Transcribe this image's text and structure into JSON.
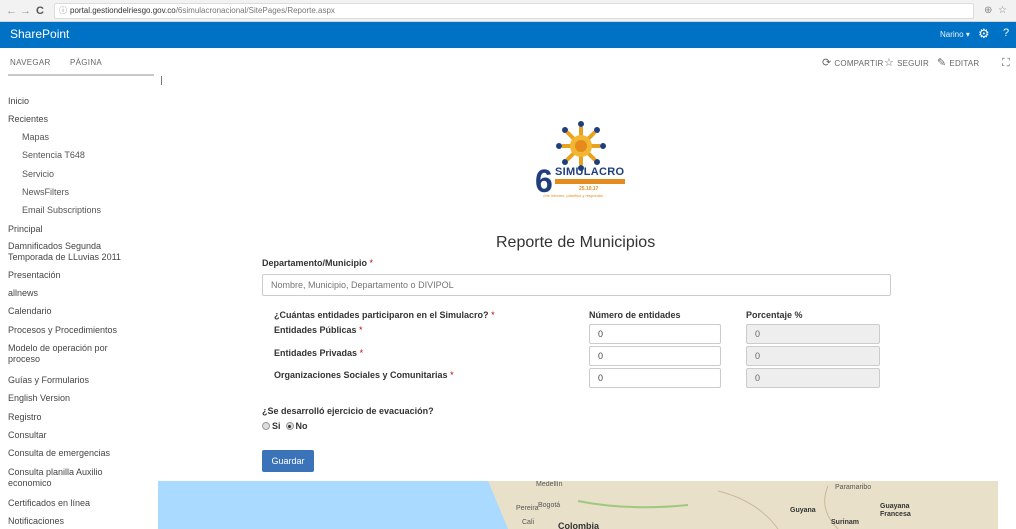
{
  "browser": {
    "url_host": "portal.gestiondelriesgo.gov.co",
    "url_path": "/6simulacronacional/SitePages/Reporte.aspx"
  },
  "suitebar": {
    "brand": "SharePoint",
    "user": "Narino"
  },
  "ribbon": {
    "tabs": [
      "NAVEGAR",
      "PÁGINA"
    ],
    "actions": {
      "share": "COMPARTIR",
      "follow": "SEGUIR",
      "edit": "EDITAR"
    }
  },
  "leftnav": {
    "items": [
      {
        "label": "Inicio",
        "sub": false
      },
      {
        "label": "Recientes",
        "sub": false
      },
      {
        "label": "Mapas",
        "sub": true
      },
      {
        "label": "Sentencia T648",
        "sub": true
      },
      {
        "label": "Servicio",
        "sub": true
      },
      {
        "label": "NewsFilters",
        "sub": true
      },
      {
        "label": "Email Subscriptions",
        "sub": true
      },
      {
        "label": "Principal",
        "sub": false
      },
      {
        "label": "Damnificados Segunda Temporada de LLuvias 2011",
        "sub": false
      },
      {
        "label": "Presentación",
        "sub": false
      },
      {
        "label": "allnews",
        "sub": false
      },
      {
        "label": "Calendario",
        "sub": false
      },
      {
        "label": "Procesos y Procedimientos",
        "sub": false
      },
      {
        "label": "Modelo de operación por proceso",
        "sub": false
      },
      {
        "label": "Guías y Formularios",
        "sub": false
      },
      {
        "label": "English Version",
        "sub": false
      },
      {
        "label": "Registro",
        "sub": false
      },
      {
        "label": "Consultar",
        "sub": false
      },
      {
        "label": "Consulta de emergencias",
        "sub": false
      },
      {
        "label": "Consulta planilla Auxilio economico",
        "sub": false
      },
      {
        "label": "Certificados en línea",
        "sub": false
      },
      {
        "label": "Notificaciones",
        "sub": false
      }
    ]
  },
  "banner": {
    "number": "6",
    "title": "SIMULACRO",
    "date": "25.10.17",
    "tagline": "¡Me informo, planifico y respondo!"
  },
  "form": {
    "title": "Reporte de Municipios",
    "dept_label": "Departamento/Municipio",
    "required_mark": "*",
    "search_placeholder": "Nombre, Municipio, Departamento o DIVIPOL",
    "entities_question": "¿Cuántas entidades participaron en el Simulacro?",
    "col_number": "Número de entidades",
    "col_percent": "Porcentaje %",
    "rows": [
      {
        "label": "Entidades Públicas",
        "number": "0",
        "percent": "0"
      },
      {
        "label": "Entidades Privadas",
        "number": "0",
        "percent": "0"
      },
      {
        "label": "Organizaciones Sociales y Comunitarias",
        "number": "0",
        "percent": "0"
      }
    ],
    "evac_question": "¿Se desarrolló ejercicio de evacuación?",
    "opt_yes": "Si",
    "opt_no": "No",
    "selected": "No",
    "save_label": "Guardar"
  },
  "map": {
    "labels": [
      "Medellín",
      "Pereira",
      "Bogotá",
      "Cali",
      "Colombia",
      "Guyana",
      "Paramaribo",
      "Surinam",
      "Guayana Francesa"
    ]
  },
  "colors": {
    "suitebar": "#0072c6",
    "save_button": "#3b73b9",
    "required": "#cc0000",
    "map_water": "#aadaff",
    "map_land": "#e8e0c8"
  }
}
